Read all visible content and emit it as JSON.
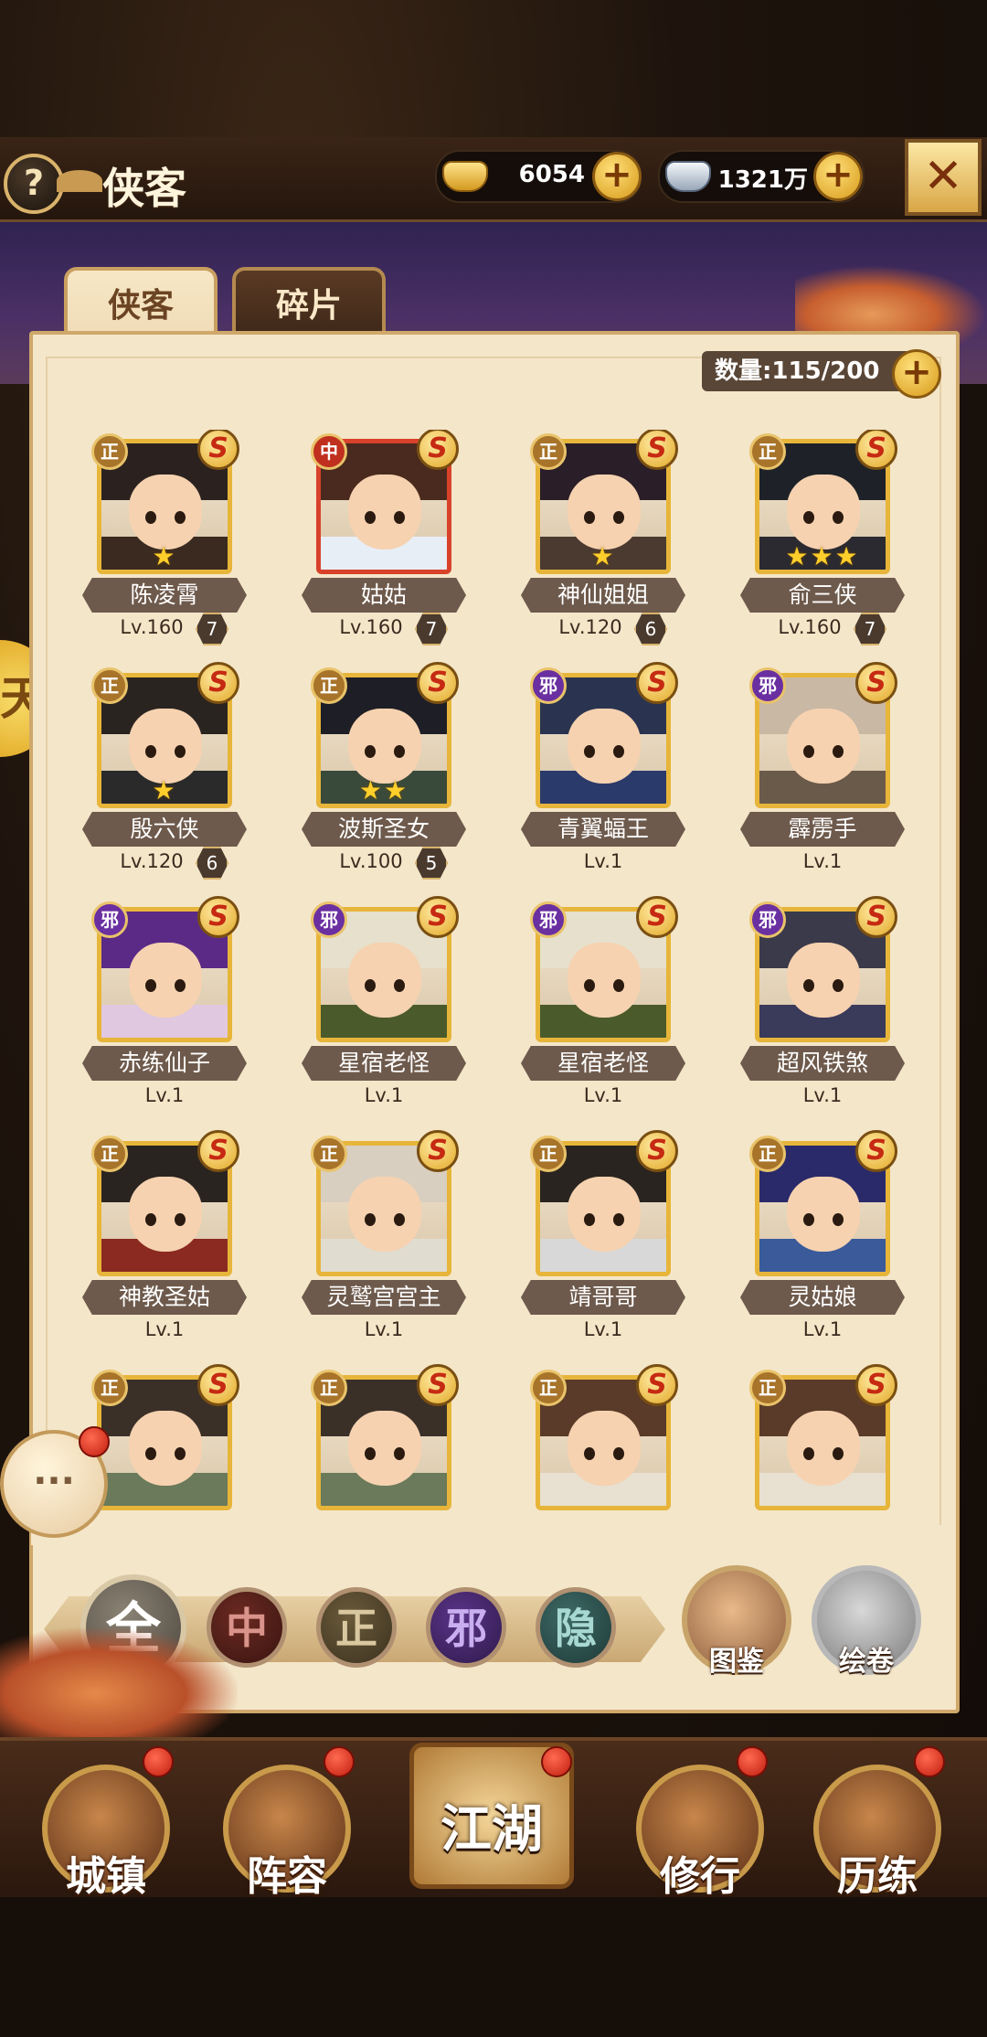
{
  "header": {
    "help_label": "?",
    "title": "侠客",
    "gold": {
      "value": "6054",
      "plus": "+"
    },
    "silver": {
      "value": "1321万",
      "plus": "+"
    },
    "close_label": "✕"
  },
  "tabs": [
    {
      "label": "侠客",
      "active": true
    },
    {
      "label": "碎片",
      "active": false
    }
  ],
  "count": {
    "label": "数量:115/200",
    "plus": "+"
  },
  "side_tab": {
    "label": "天"
  },
  "heroes": [
    {
      "name": "陈凌霄",
      "level": "Lv.160",
      "breakthrough": "7",
      "faction": "正",
      "rank": "S",
      "stars": 1
    },
    {
      "name": "姑姑",
      "level": "Lv.160",
      "breakthrough": "7",
      "faction": "中",
      "rank": "S",
      "stars": 0
    },
    {
      "name": "神仙姐姐",
      "level": "Lv.120",
      "breakthrough": "6",
      "faction": "正",
      "rank": "S",
      "stars": 1
    },
    {
      "name": "俞三侠",
      "level": "Lv.160",
      "breakthrough": "7",
      "faction": "正",
      "rank": "S",
      "stars": 3
    },
    {
      "name": "殷六侠",
      "level": "Lv.120",
      "breakthrough": "6",
      "faction": "正",
      "rank": "S",
      "stars": 1
    },
    {
      "name": "波斯圣女",
      "level": "Lv.100",
      "breakthrough": "5",
      "faction": "正",
      "rank": "S",
      "stars": 2
    },
    {
      "name": "青翼蝠王",
      "level": "Lv.1",
      "breakthrough": "",
      "faction": "邪",
      "rank": "S",
      "stars": 0
    },
    {
      "name": "霹雳手",
      "level": "Lv.1",
      "breakthrough": "",
      "faction": "邪",
      "rank": "S",
      "stars": 0
    },
    {
      "name": "赤练仙子",
      "level": "Lv.1",
      "breakthrough": "",
      "faction": "邪",
      "rank": "S",
      "stars": 0
    },
    {
      "name": "星宿老怪",
      "level": "Lv.1",
      "breakthrough": "",
      "faction": "邪",
      "rank": "S",
      "stars": 0
    },
    {
      "name": "星宿老怪",
      "level": "Lv.1",
      "breakthrough": "",
      "faction": "邪",
      "rank": "S",
      "stars": 0
    },
    {
      "name": "超风铁煞",
      "level": "Lv.1",
      "breakthrough": "",
      "faction": "邪",
      "rank": "S",
      "stars": 0
    },
    {
      "name": "神教圣姑",
      "level": "Lv.1",
      "breakthrough": "",
      "faction": "正",
      "rank": "S",
      "stars": 0
    },
    {
      "name": "灵鹫宫宫主",
      "level": "Lv.1",
      "breakthrough": "",
      "faction": "正",
      "rank": "S",
      "stars": 0
    },
    {
      "name": "靖哥哥",
      "level": "Lv.1",
      "breakthrough": "",
      "faction": "正",
      "rank": "S",
      "stars": 0
    },
    {
      "name": "灵姑娘",
      "level": "Lv.1",
      "breakthrough": "",
      "faction": "正",
      "rank": "S",
      "stars": 0
    },
    {
      "name": "",
      "level": "",
      "breakthrough": "",
      "faction": "正",
      "rank": "S",
      "stars": 0
    },
    {
      "name": "",
      "level": "",
      "breakthrough": "",
      "faction": "正",
      "rank": "S",
      "stars": 0
    },
    {
      "name": "",
      "level": "",
      "breakthrough": "",
      "faction": "正",
      "rank": "S",
      "stars": 0
    },
    {
      "name": "",
      "level": "",
      "breakthrough": "",
      "faction": "正",
      "rank": "S",
      "stars": 0
    }
  ],
  "filters": {
    "all": "全",
    "zhong": "中",
    "zheng": "正",
    "xie": "邪",
    "yin": "隐"
  },
  "actions": {
    "atlas": "图鉴",
    "scroll": "绘卷"
  },
  "chat": {
    "label": "···"
  },
  "nav": {
    "town": "城镇",
    "lineup": "阵容",
    "jianghu": "江湖",
    "training": "修行",
    "trial": "历练"
  },
  "colors": {
    "accent": "#e7b53a",
    "panel": "#f4e6c9",
    "faction_zheng": "#a8742a",
    "faction_xie": "#6a2fa0",
    "faction_zhong": "#c0301e"
  }
}
